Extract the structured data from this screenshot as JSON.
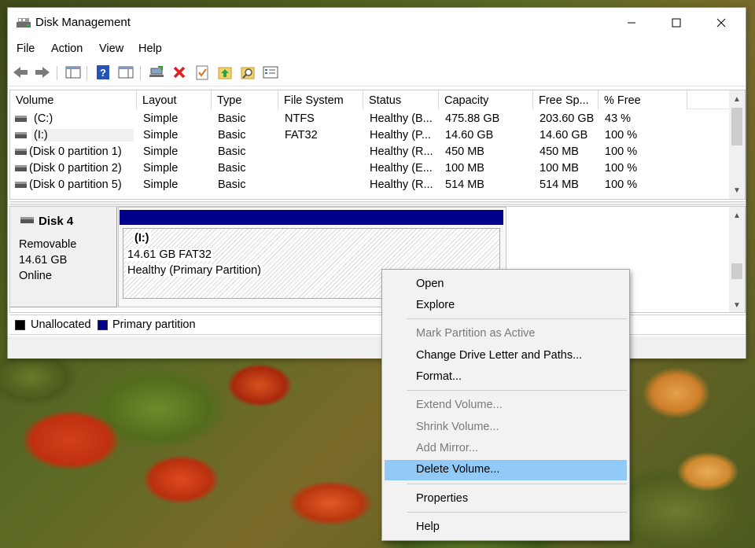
{
  "window": {
    "title": "Disk Management"
  },
  "menu": [
    "File",
    "Action",
    "View",
    "Help"
  ],
  "columns": [
    "Volume",
    "Layout",
    "Type",
    "File System",
    "Status",
    "Capacity",
    "Free Sp...",
    "% Free"
  ],
  "volumes": [
    {
      "volume": "(C:)",
      "layout": "Simple",
      "type": "Basic",
      "fs": "NTFS",
      "status": "Healthy (B...",
      "capacity": "475.88 GB",
      "free": "203.60 GB",
      "pct": "43 %"
    },
    {
      "volume": "(I:)",
      "layout": "Simple",
      "type": "Basic",
      "fs": "FAT32",
      "status": "Healthy (P...",
      "capacity": "14.60 GB",
      "free": "14.60 GB",
      "pct": "100 %"
    },
    {
      "volume": "(Disk 0 partition 1)",
      "layout": "Simple",
      "type": "Basic",
      "fs": "",
      "status": "Healthy (R...",
      "capacity": "450 MB",
      "free": "450 MB",
      "pct": "100 %"
    },
    {
      "volume": "(Disk 0 partition 2)",
      "layout": "Simple",
      "type": "Basic",
      "fs": "",
      "status": "Healthy (E...",
      "capacity": "100 MB",
      "free": "100 MB",
      "pct": "100 %"
    },
    {
      "volume": "(Disk 0 partition 5)",
      "layout": "Simple",
      "type": "Basic",
      "fs": "",
      "status": "Healthy (R...",
      "capacity": "514 MB",
      "free": "514 MB",
      "pct": "100 %"
    }
  ],
  "disk": {
    "name": "Disk 4",
    "type": "Removable",
    "size": "14.61 GB",
    "state": "Online",
    "partition": {
      "label": "(I:)",
      "size_fs": "14.61 GB FAT32",
      "status": "Healthy (Primary Partition)"
    }
  },
  "legend": {
    "unallocated": "Unallocated",
    "primary": "Primary partition"
  },
  "context_menu": {
    "open": "Open",
    "explore": "Explore",
    "mark_active": "Mark Partition as Active",
    "change_letter": "Change Drive Letter and Paths...",
    "format": "Format...",
    "extend": "Extend Volume...",
    "shrink": "Shrink Volume...",
    "add_mirror": "Add Mirror...",
    "delete": "Delete Volume...",
    "properties": "Properties",
    "help": "Help"
  },
  "colors": {
    "primary_partition": "#00008b",
    "menu_highlight": "#91c9f7"
  }
}
